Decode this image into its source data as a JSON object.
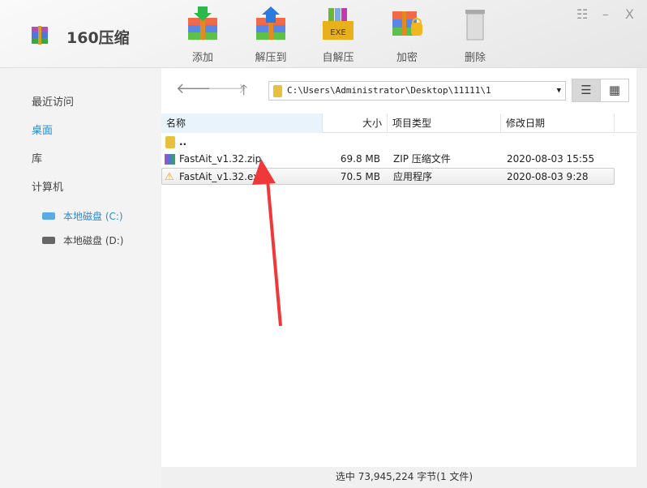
{
  "app": {
    "title": "160压缩"
  },
  "toolbar": [
    {
      "label": "添加",
      "icon": "add-archive-icon"
    },
    {
      "label": "解压到",
      "icon": "extract-to-icon"
    },
    {
      "label": "自解压",
      "icon": "self-extract-exe-icon",
      "badge": "EXE"
    },
    {
      "label": "加密",
      "icon": "encrypt-lock-icon"
    },
    {
      "label": "删除",
      "icon": "trash-icon"
    }
  ],
  "window": {
    "menu": "☷",
    "minimize": "–",
    "close": "X"
  },
  "sidebar": {
    "items": [
      "最近访问",
      "桌面",
      "库",
      "计算机"
    ],
    "drives": [
      "本地磁盘 (C:)",
      "本地磁盘 (D:)"
    ],
    "active": "桌面"
  },
  "address": {
    "path": "C:\\Users\\Administrator\\Desktop\\11111\\1"
  },
  "columns": {
    "name": "名称",
    "size": "大小",
    "type": "项目类型",
    "date": "修改日期"
  },
  "files": [
    {
      "name": "..",
      "size": "",
      "type": "",
      "date": ""
    },
    {
      "name": "FastAit_v1.32.zip",
      "size": "69.8 MB",
      "type": "ZIP 压缩文件",
      "date": "2020-08-03 15:55"
    },
    {
      "name": "FastAit_v1.32.exe",
      "size": "70.5 MB",
      "type": "应用程序",
      "date": "2020-08-03 9:28"
    }
  ],
  "status": "选中  73,945,224 字节(1 文件)",
  "colors": {
    "accent": "#2a8ad8",
    "arrow": "#f0383a"
  }
}
